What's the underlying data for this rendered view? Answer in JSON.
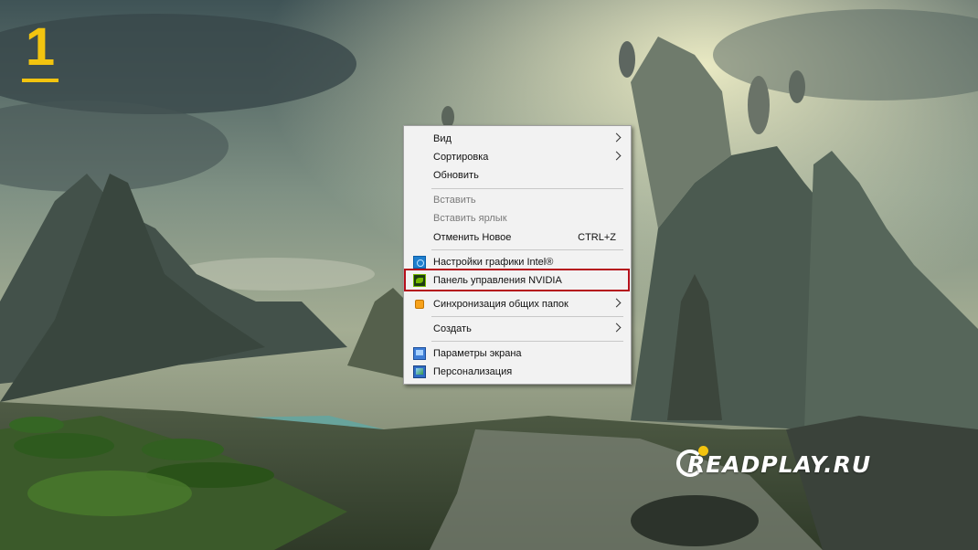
{
  "step": {
    "number": "1",
    "accent_color": "#f2c40f"
  },
  "watermark": {
    "text": "READPLAY.RU"
  },
  "context_menu": {
    "items": [
      {
        "label": "Вид",
        "submenu": true
      },
      {
        "label": "Сортировка",
        "submenu": true
      },
      {
        "label": "Обновить"
      },
      {
        "label": "Вставить",
        "disabled": true
      },
      {
        "label": "Вставить ярлык",
        "disabled": true
      },
      {
        "label": "Отменить Новое",
        "shortcut": "CTRL+Z"
      },
      {
        "label": "Настройки графики Intel®",
        "icon": "intel-graphics-icon"
      },
      {
        "label": "Панель управления NVIDIA",
        "icon": "nvidia-icon",
        "highlighted": true
      },
      {
        "label": "Синхронизация общих папок",
        "icon": "sync-folders-icon",
        "submenu": true
      },
      {
        "label": "Создать",
        "submenu": true
      },
      {
        "label": "Параметры экрана",
        "icon": "display-settings-icon"
      },
      {
        "label": "Персонализация",
        "icon": "personalization-icon"
      }
    ],
    "highlight_color": "#b5101b"
  }
}
